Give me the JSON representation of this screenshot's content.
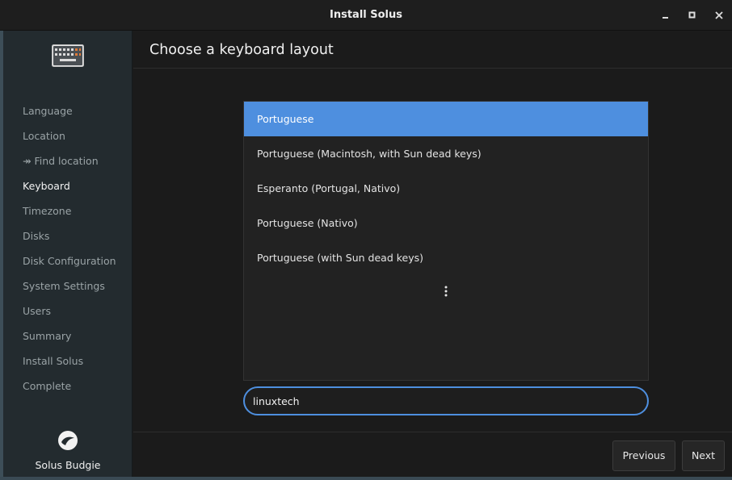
{
  "window": {
    "title": "Install Solus"
  },
  "sidebar": {
    "items": [
      {
        "label": "Language"
      },
      {
        "label": "Location"
      },
      {
        "label": "↠ Find location"
      },
      {
        "label": "Keyboard"
      },
      {
        "label": "Timezone"
      },
      {
        "label": "Disks"
      },
      {
        "label": "Disk Configuration"
      },
      {
        "label": "System Settings"
      },
      {
        "label": "Users"
      },
      {
        "label": "Summary"
      },
      {
        "label": "Install Solus"
      },
      {
        "label": "Complete"
      }
    ],
    "active_label": "Keyboard",
    "header_icon": "keyboard-icon",
    "brand_icon": "solus-logo-icon",
    "brand_name": "Solus Budgie"
  },
  "main": {
    "heading": "Choose a keyboard layout",
    "layouts": [
      {
        "label": "Portuguese",
        "selected": true
      },
      {
        "label": "Portuguese (Macintosh, with Sun dead keys)",
        "selected": false
      },
      {
        "label": "Esperanto (Portugal, Nativo)",
        "selected": false
      },
      {
        "label": "Portuguese (Nativo)",
        "selected": false
      },
      {
        "label": "Portuguese (with Sun dead keys)",
        "selected": false
      }
    ],
    "more_icon": "more-vertical-icon",
    "search": {
      "value": "linuxtech"
    },
    "previous_label": "Previous",
    "next_label": "Next"
  },
  "colors": {
    "accent": "#4e8fdf",
    "sidebar_bg": "#232b2f",
    "content_bg": "#1b1b1b",
    "titlebar_bg": "#1e1e1e"
  }
}
